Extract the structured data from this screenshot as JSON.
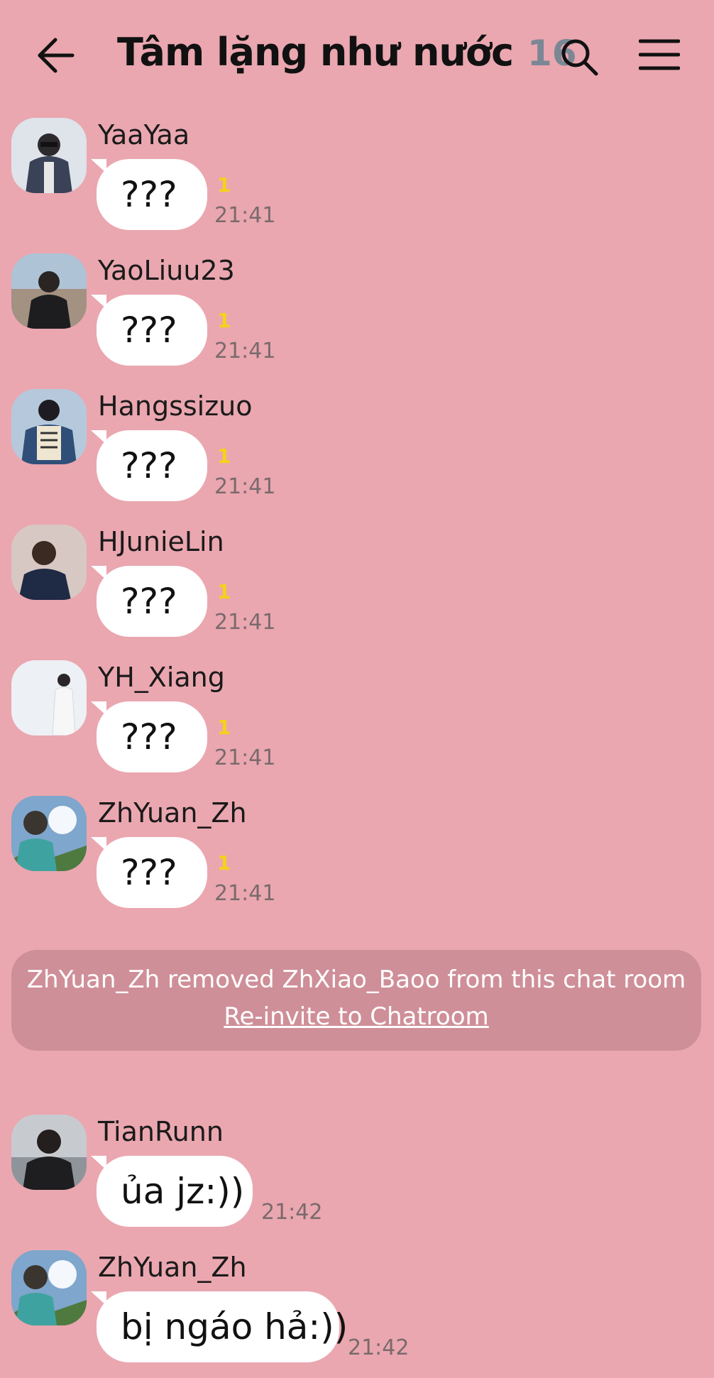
{
  "header": {
    "back_icon": "arrow-left-icon",
    "title": "Tâm lặng như nước",
    "member_count": "16",
    "search_icon": "search-icon",
    "menu_icon": "hamburger-menu-icon"
  },
  "messages": [
    {
      "sender": "YaaYaa",
      "text": "???",
      "unread": "1",
      "time": "21:41"
    },
    {
      "sender": "YaoLiuu23",
      "text": "???",
      "unread": "1",
      "time": "21:41"
    },
    {
      "sender": "Hangssizuo",
      "text": "???",
      "unread": "1",
      "time": "21:41"
    },
    {
      "sender": "HJunieLin",
      "text": "???",
      "unread": "1",
      "time": "21:41"
    },
    {
      "sender": "YH_Xiang",
      "text": "???",
      "unread": "1",
      "time": "21:41"
    },
    {
      "sender": "ZhYuan_Zh",
      "text": "???",
      "unread": "1",
      "time": "21:41"
    }
  ],
  "notice": {
    "text": "ZhYuan_Zh removed ZhXiao_Baoo from this chat room",
    "link": "Re-invite to Chatroom"
  },
  "messages_after": [
    {
      "sender": "TianRunn",
      "text": "ủa jz:))",
      "time": "21:42"
    },
    {
      "sender": "ZhYuan_Zh",
      "text": "bị ngáo hả:))",
      "time": "21:42"
    }
  ],
  "colors": {
    "background": "#eaa7b0",
    "bubble": "#ffffff",
    "unread": "#f5d21a",
    "notice": "#cf8f98",
    "member_count": "#7b8794"
  }
}
